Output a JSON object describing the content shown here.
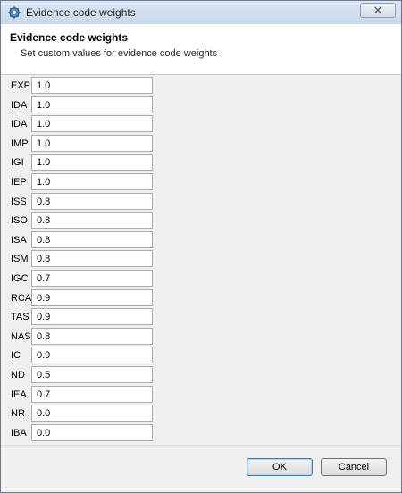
{
  "window": {
    "title": "Evidence code weights",
    "icon": "gear-icon"
  },
  "header": {
    "title": "Evidence code weights",
    "subtitle": "Set custom values for evidence code weights"
  },
  "rows": [
    {
      "code": "EXP",
      "value": "1.0"
    },
    {
      "code": "IDA",
      "value": "1.0"
    },
    {
      "code": "IDA",
      "value": "1.0"
    },
    {
      "code": "IMP",
      "value": "1.0"
    },
    {
      "code": "IGI",
      "value": "1.0"
    },
    {
      "code": "IEP",
      "value": "1.0"
    },
    {
      "code": "ISS",
      "value": "0.8"
    },
    {
      "code": "ISO",
      "value": "0.8"
    },
    {
      "code": "ISA",
      "value": "0.8"
    },
    {
      "code": "ISM",
      "value": "0.8"
    },
    {
      "code": "IGC",
      "value": "0.7"
    },
    {
      "code": "RCA",
      "value": "0.9"
    },
    {
      "code": "TAS",
      "value": "0.9"
    },
    {
      "code": "NAS",
      "value": "0.8"
    },
    {
      "code": "IC",
      "value": "0.9"
    },
    {
      "code": "ND",
      "value": "0.5"
    },
    {
      "code": "IEA",
      "value": "0.7"
    },
    {
      "code": "NR",
      "value": "0.0"
    },
    {
      "code": "IBA",
      "value": "0.0"
    }
  ],
  "buttons": {
    "ok": "OK",
    "cancel": "Cancel"
  }
}
